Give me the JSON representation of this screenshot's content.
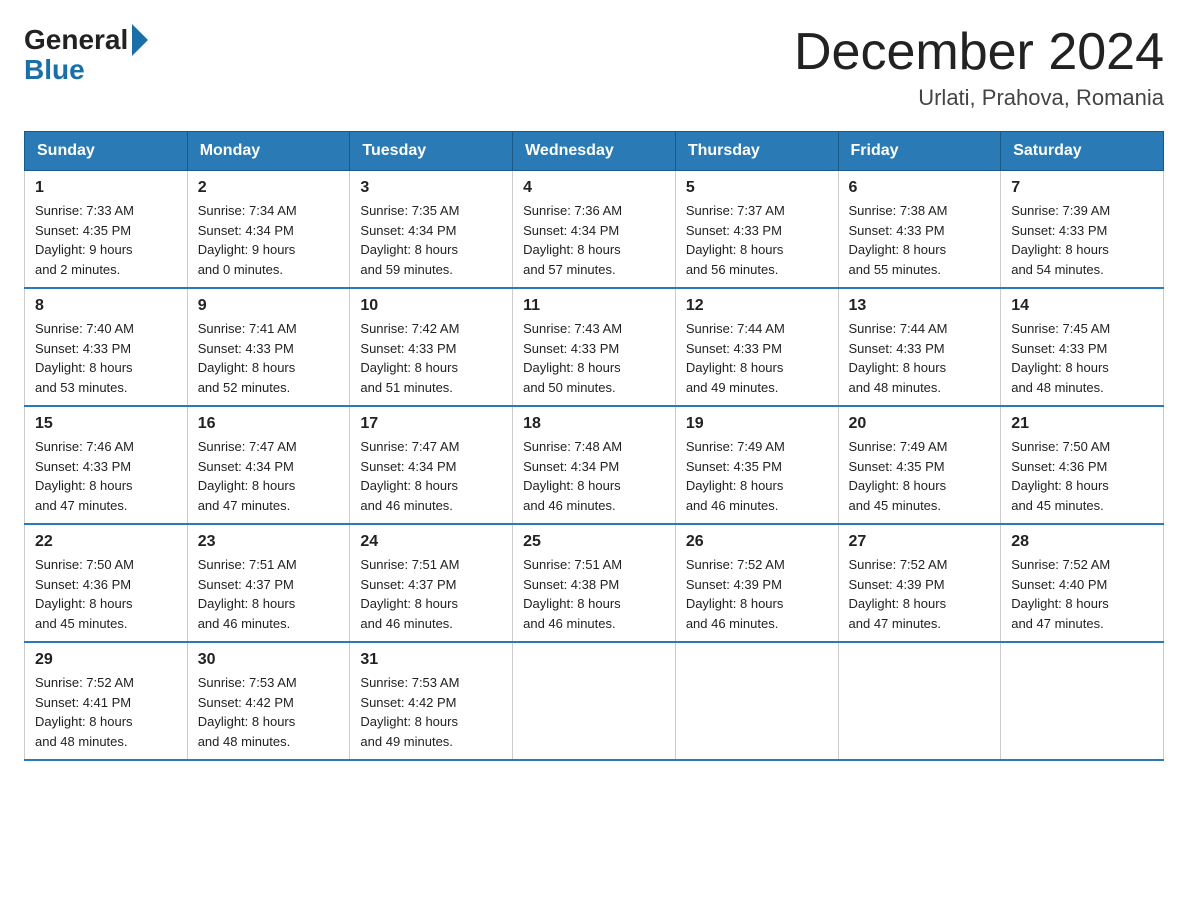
{
  "header": {
    "logo_general": "General",
    "logo_blue": "Blue",
    "main_title": "December 2024",
    "subtitle": "Urlati, Prahova, Romania"
  },
  "calendar": {
    "days_of_week": [
      "Sunday",
      "Monday",
      "Tuesday",
      "Wednesday",
      "Thursday",
      "Friday",
      "Saturday"
    ],
    "weeks": [
      [
        {
          "day": "1",
          "sunrise": "7:33 AM",
          "sunset": "4:35 PM",
          "daylight": "9 hours and 2 minutes."
        },
        {
          "day": "2",
          "sunrise": "7:34 AM",
          "sunset": "4:34 PM",
          "daylight": "9 hours and 0 minutes."
        },
        {
          "day": "3",
          "sunrise": "7:35 AM",
          "sunset": "4:34 PM",
          "daylight": "8 hours and 59 minutes."
        },
        {
          "day": "4",
          "sunrise": "7:36 AM",
          "sunset": "4:34 PM",
          "daylight": "8 hours and 57 minutes."
        },
        {
          "day": "5",
          "sunrise": "7:37 AM",
          "sunset": "4:33 PM",
          "daylight": "8 hours and 56 minutes."
        },
        {
          "day": "6",
          "sunrise": "7:38 AM",
          "sunset": "4:33 PM",
          "daylight": "8 hours and 55 minutes."
        },
        {
          "day": "7",
          "sunrise": "7:39 AM",
          "sunset": "4:33 PM",
          "daylight": "8 hours and 54 minutes."
        }
      ],
      [
        {
          "day": "8",
          "sunrise": "7:40 AM",
          "sunset": "4:33 PM",
          "daylight": "8 hours and 53 minutes."
        },
        {
          "day": "9",
          "sunrise": "7:41 AM",
          "sunset": "4:33 PM",
          "daylight": "8 hours and 52 minutes."
        },
        {
          "day": "10",
          "sunrise": "7:42 AM",
          "sunset": "4:33 PM",
          "daylight": "8 hours and 51 minutes."
        },
        {
          "day": "11",
          "sunrise": "7:43 AM",
          "sunset": "4:33 PM",
          "daylight": "8 hours and 50 minutes."
        },
        {
          "day": "12",
          "sunrise": "7:44 AM",
          "sunset": "4:33 PM",
          "daylight": "8 hours and 49 minutes."
        },
        {
          "day": "13",
          "sunrise": "7:44 AM",
          "sunset": "4:33 PM",
          "daylight": "8 hours and 48 minutes."
        },
        {
          "day": "14",
          "sunrise": "7:45 AM",
          "sunset": "4:33 PM",
          "daylight": "8 hours and 48 minutes."
        }
      ],
      [
        {
          "day": "15",
          "sunrise": "7:46 AM",
          "sunset": "4:33 PM",
          "daylight": "8 hours and 47 minutes."
        },
        {
          "day": "16",
          "sunrise": "7:47 AM",
          "sunset": "4:34 PM",
          "daylight": "8 hours and 47 minutes."
        },
        {
          "day": "17",
          "sunrise": "7:47 AM",
          "sunset": "4:34 PM",
          "daylight": "8 hours and 46 minutes."
        },
        {
          "day": "18",
          "sunrise": "7:48 AM",
          "sunset": "4:34 PM",
          "daylight": "8 hours and 46 minutes."
        },
        {
          "day": "19",
          "sunrise": "7:49 AM",
          "sunset": "4:35 PM",
          "daylight": "8 hours and 46 minutes."
        },
        {
          "day": "20",
          "sunrise": "7:49 AM",
          "sunset": "4:35 PM",
          "daylight": "8 hours and 45 minutes."
        },
        {
          "day": "21",
          "sunrise": "7:50 AM",
          "sunset": "4:36 PM",
          "daylight": "8 hours and 45 minutes."
        }
      ],
      [
        {
          "day": "22",
          "sunrise": "7:50 AM",
          "sunset": "4:36 PM",
          "daylight": "8 hours and 45 minutes."
        },
        {
          "day": "23",
          "sunrise": "7:51 AM",
          "sunset": "4:37 PM",
          "daylight": "8 hours and 46 minutes."
        },
        {
          "day": "24",
          "sunrise": "7:51 AM",
          "sunset": "4:37 PM",
          "daylight": "8 hours and 46 minutes."
        },
        {
          "day": "25",
          "sunrise": "7:51 AM",
          "sunset": "4:38 PM",
          "daylight": "8 hours and 46 minutes."
        },
        {
          "day": "26",
          "sunrise": "7:52 AM",
          "sunset": "4:39 PM",
          "daylight": "8 hours and 46 minutes."
        },
        {
          "day": "27",
          "sunrise": "7:52 AM",
          "sunset": "4:39 PM",
          "daylight": "8 hours and 47 minutes."
        },
        {
          "day": "28",
          "sunrise": "7:52 AM",
          "sunset": "4:40 PM",
          "daylight": "8 hours and 47 minutes."
        }
      ],
      [
        {
          "day": "29",
          "sunrise": "7:52 AM",
          "sunset": "4:41 PM",
          "daylight": "8 hours and 48 minutes."
        },
        {
          "day": "30",
          "sunrise": "7:53 AM",
          "sunset": "4:42 PM",
          "daylight": "8 hours and 48 minutes."
        },
        {
          "day": "31",
          "sunrise": "7:53 AM",
          "sunset": "4:42 PM",
          "daylight": "8 hours and 49 minutes."
        },
        null,
        null,
        null,
        null
      ]
    ]
  }
}
